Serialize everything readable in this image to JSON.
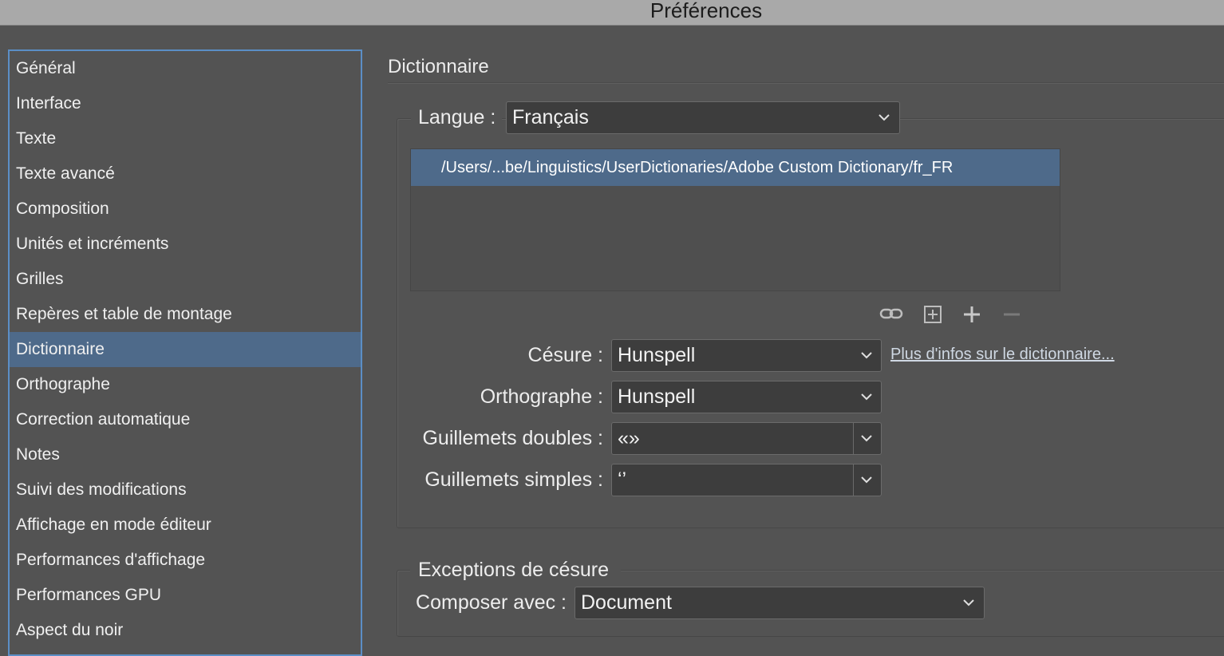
{
  "window": {
    "title": "Préférences"
  },
  "sidebar": {
    "items": [
      {
        "label": "Général"
      },
      {
        "label": "Interface"
      },
      {
        "label": "Texte"
      },
      {
        "label": "Texte avancé"
      },
      {
        "label": "Composition"
      },
      {
        "label": "Unités et incréments"
      },
      {
        "label": "Grilles"
      },
      {
        "label": "Repères et table de montage"
      },
      {
        "label": "Dictionnaire",
        "selected": true
      },
      {
        "label": "Orthographe"
      },
      {
        "label": "Correction automatique"
      },
      {
        "label": "Notes"
      },
      {
        "label": "Suivi des modifications"
      },
      {
        "label": "Affichage en mode éditeur"
      },
      {
        "label": "Performances d'affichage"
      },
      {
        "label": "Performances GPU"
      },
      {
        "label": "Aspect du noir"
      }
    ]
  },
  "main": {
    "title": "Dictionnaire",
    "language": {
      "label": "Langue :",
      "value": "Français"
    },
    "dictionary_list": {
      "items": [
        "/Users/...be/Linguistics/UserDictionaries/Adobe Custom Dictionary/fr_FR"
      ]
    },
    "list_actions": {
      "icons": [
        "link-icon",
        "new-dictionary-icon",
        "add-icon",
        "remove-icon"
      ]
    },
    "hyphenation": {
      "label": "Césure :",
      "value": "Hunspell"
    },
    "more_info_link": "Plus d'infos sur le dictionnaire...",
    "spelling": {
      "label": "Orthographe :",
      "value": "Hunspell"
    },
    "double_quotes": {
      "label": "Guillemets doubles :",
      "value": "«»"
    },
    "single_quotes": {
      "label": "Guillemets simples :",
      "value": "‘’"
    },
    "exceptions": {
      "title": "Exceptions de césure",
      "compose_label": "Composer avec :",
      "compose_value": "Document"
    }
  },
  "colors": {
    "background": "#535353",
    "selection": "#4e6a8a",
    "focus_border": "#5b8ec6",
    "field": "#3d3d3d"
  }
}
